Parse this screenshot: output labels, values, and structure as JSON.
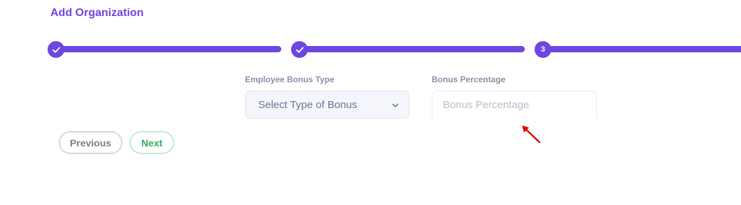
{
  "header": {
    "title": "Add Organization"
  },
  "stepper": {
    "steps": [
      {
        "state": "completed",
        "icon": "check-icon"
      },
      {
        "state": "completed",
        "icon": "check-icon"
      },
      {
        "state": "active",
        "number": "3"
      }
    ],
    "accent_color": "#6d47e0"
  },
  "form": {
    "bonus_type": {
      "label": "Employee Bonus Type",
      "value": "Select Type of Bonus",
      "icon": "chevron-down-icon"
    },
    "bonus_percentage": {
      "label": "Bonus Percentage",
      "value": "",
      "placeholder": "Bonus Percentage"
    }
  },
  "annotation": {
    "icon": "red-arrow-pointer-icon",
    "color": "#e00000"
  },
  "actions": {
    "previous_label": "Previous",
    "next_label": "Next"
  }
}
